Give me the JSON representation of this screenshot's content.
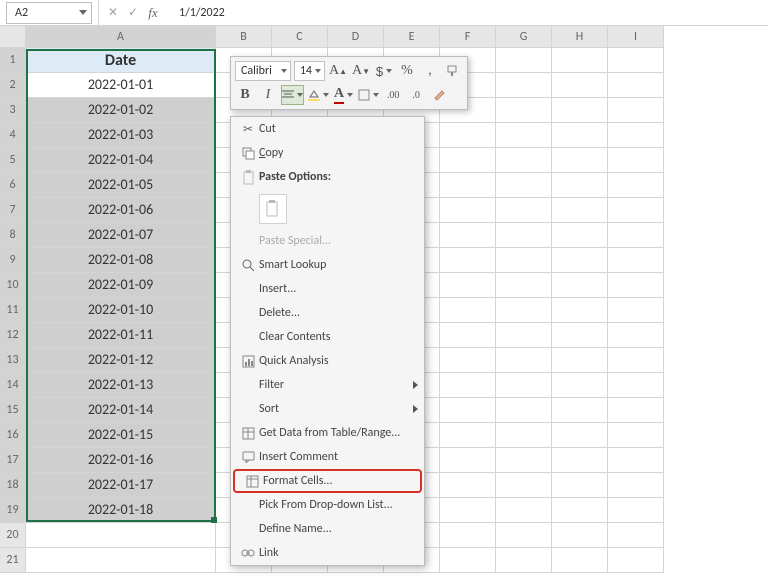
{
  "namebox": {
    "value": "A2"
  },
  "formula_bar": {
    "value": "1/1/2022"
  },
  "columns": [
    "A",
    "B",
    "C",
    "D",
    "E",
    "F",
    "G",
    "H",
    "I"
  ],
  "rows": [
    1,
    2,
    3,
    4,
    5,
    6,
    7,
    8,
    9,
    10,
    11,
    12,
    13,
    14,
    15,
    16,
    17,
    18,
    19,
    20,
    21
  ],
  "header_cell": "Date",
  "data": [
    "2022-01-01",
    "2022-01-02",
    "2022-01-03",
    "2022-01-04",
    "2022-01-05",
    "2022-01-06",
    "2022-01-07",
    "2022-01-08",
    "2022-01-09",
    "2022-01-10",
    "2022-01-11",
    "2022-01-12",
    "2022-01-13",
    "2022-01-14",
    "2022-01-15",
    "2022-01-16",
    "2022-01-17",
    "2022-01-18"
  ],
  "mini_toolbar": {
    "font_name": "Calibri",
    "font_size": "14",
    "percent": "%",
    "comma": ","
  },
  "context_menu": {
    "cut": "Cut",
    "copy": "Copy",
    "paste_options": "Paste Options:",
    "paste_special": "Paste Special...",
    "smart_lookup": "Smart Lookup",
    "insert": "Insert...",
    "delete": "Delete...",
    "clear_contents": "Clear Contents",
    "quick_analysis": "Quick Analysis",
    "filter": "Filter",
    "sort": "Sort",
    "get_data": "Get Data from Table/Range...",
    "insert_comment": "Insert Comment",
    "format_cells": "Format Cells...",
    "pick_list": "Pick From Drop-down List...",
    "define_name": "Define Name...",
    "link": "Link"
  }
}
